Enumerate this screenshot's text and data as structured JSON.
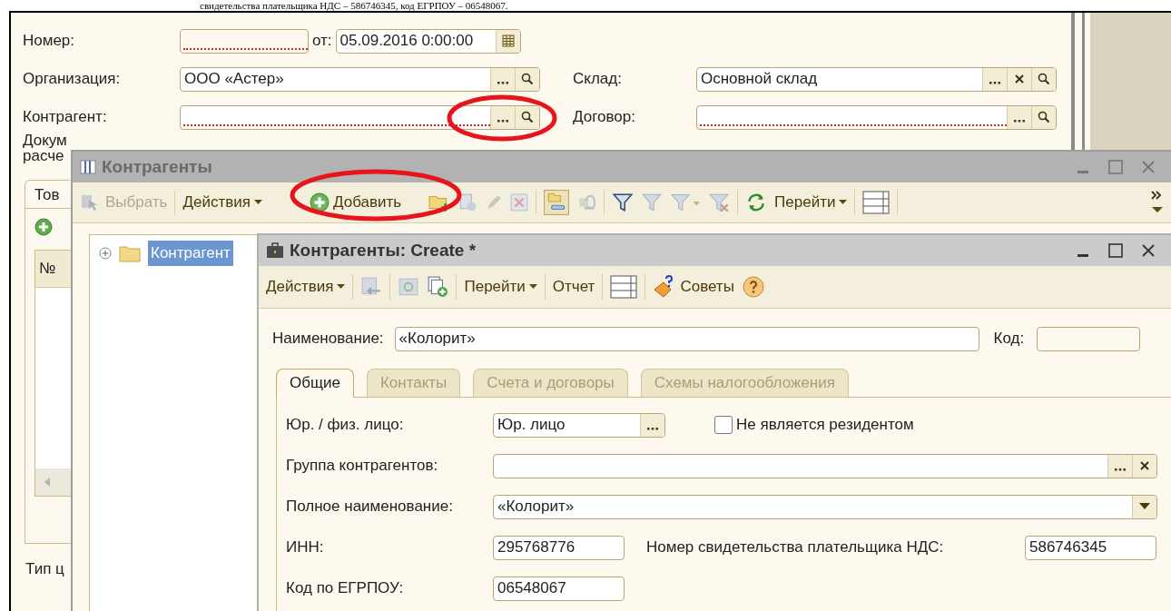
{
  "page_caption": "свидетельства плательщика НДС – 586746345, код ЕГРПОУ – 06548067.",
  "document_form": {
    "number": {
      "label": "Номер:",
      "required": true
    },
    "date": {
      "label": "от:",
      "value": "05.09.2016  0:00:00"
    },
    "organization": {
      "label": "Организация:",
      "value": "ООО «Астер»",
      "required": false
    },
    "warehouse": {
      "label": "Склад:",
      "value": "Основной склад",
      "required": false
    },
    "counterparty": {
      "label": "Контрагент:",
      "required": true
    },
    "contract": {
      "label": "Договор:",
      "required": true
    },
    "settlement_label_lines": [
      "Докум",
      "расче"
    ],
    "tab": "Тов",
    "table_column": "№",
    "price_type_label": "Тип ц"
  },
  "catalog_window": {
    "title": "Контрагенты",
    "toolbar": [
      {
        "label": "Выбрать",
        "disabled": true
      },
      {
        "label": "Действия",
        "disabled": false
      },
      {
        "label": "Добавить",
        "disabled": false
      },
      {
        "label": "Перейти",
        "disabled": false
      }
    ],
    "tree": [
      {
        "label": "Контрагент",
        "selected": true
      }
    ]
  },
  "create_window": {
    "title": "Контрагенты: Create *",
    "toolbar": [
      {
        "label": "Действия"
      },
      {
        "label": "Перейти"
      },
      {
        "label": "Отчет"
      },
      {
        "label": "Советы"
      }
    ],
    "name": {
      "label": "Наименование:",
      "value": "«Колорит»"
    },
    "code": {
      "label": "Код:"
    },
    "tabs": [
      {
        "label": "Общие",
        "selected": true
      },
      {
        "label": "Контакты",
        "selected": false
      },
      {
        "label": "Счета и договоры",
        "selected": false
      },
      {
        "label": "Схемы налогообложения",
        "selected": false
      }
    ],
    "legal_type": {
      "label": "Юр. / физ. лицо:",
      "value": "Юр. лицо"
    },
    "non_resident": {
      "label": "Не является резидентом",
      "checked": false
    },
    "group": {
      "label": "Группа контрагентов:"
    },
    "full_name": {
      "label": "Полное наименование:",
      "value": "«Колорит»"
    },
    "inn": {
      "label": "ИНН:",
      "value": "295768776"
    },
    "vat_number": {
      "label": "Номер свидетельства плательщика НДС:",
      "value": "586746345"
    },
    "edrpou": {
      "label": "Код по ЕГРПОУ:",
      "value": "06548067"
    }
  }
}
